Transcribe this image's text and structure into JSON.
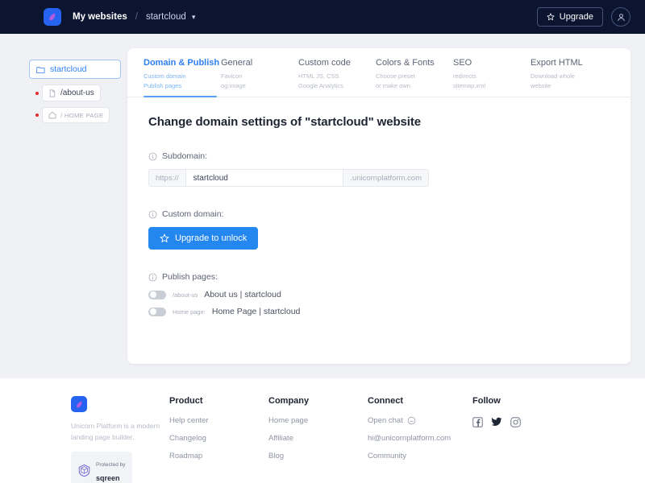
{
  "topbar": {
    "logo_icon": "unicorn-droplet-logo",
    "breadcrumb_root": "My websites",
    "breadcrumb_separator": "/",
    "breadcrumb_current": "startcloud",
    "caret_icon": "chevron-down-icon",
    "upgrade_label": "Upgrade",
    "upgrade_icon": "star-icon",
    "avatar_icon": "user-avatar-icon",
    "bg_color": "#0b1530"
  },
  "tree": {
    "root": {
      "label": "startcloud",
      "icon": "folder-icon"
    },
    "children": [
      {
        "label": "/about-us",
        "icon": "page-icon",
        "status_dot": "#e02b2b",
        "muted": false,
        "slash": ""
      },
      {
        "label": "/ HOME PAGE",
        "icon": "home-icon",
        "status_dot": "#e02b2b",
        "muted": true,
        "slash": ""
      }
    ]
  },
  "tabs": [
    {
      "title": "Domain & Publish",
      "sub1": "Custom domain",
      "sub2": "Publish pages",
      "active": true
    },
    {
      "title": "General",
      "sub1": "Favicon",
      "sub2": "og:image",
      "active": false
    },
    {
      "title": "Custom code",
      "sub1": "HTML JS, CSS",
      "sub2": "Google Analytics",
      "active": false
    },
    {
      "title": "Colors & Fonts",
      "sub1": "Choose preset",
      "sub2": "or make own",
      "active": false
    },
    {
      "title": "SEO",
      "sub1": "redirects",
      "sub2": "sitemap.xml",
      "active": false
    },
    {
      "title": "Export HTML",
      "sub1": "Download whole",
      "sub2": "website",
      "active": false
    }
  ],
  "main": {
    "page_title": "Change domain settings of \"startcloud\" website",
    "subdomain": {
      "label": "Subdomain:",
      "info_icon": "info-icon",
      "prefix": "https://",
      "value": "startcloud",
      "placeholder": "startcloud",
      "suffix": ".unicornplatform.com"
    },
    "custom_domain": {
      "label": "Custom domain:",
      "info_icon": "info-icon",
      "button_label": "Upgrade to unlock",
      "button_icon": "star-icon",
      "button_color": "#2487f0"
    },
    "publish_pages": {
      "label": "Publish pages:",
      "info_icon": "info-icon",
      "rows": [
        {
          "tag": "/about-us",
          "name": "About us | startcloud",
          "enabled": false
        },
        {
          "tag": "Home page:",
          "name": "Home Page | startcloud",
          "enabled": false
        }
      ]
    }
  },
  "footer": {
    "logo_icon": "unicorn-droplet-logo",
    "tagline": "Unicorn Platform is a modern landing page builder.",
    "badge": {
      "icon": "sqreen-shield-icon",
      "line1": "Protected by",
      "line2": "sqreen"
    },
    "columns": [
      {
        "heading": "Product",
        "links": [
          {
            "label": "Help center",
            "icon": ""
          },
          {
            "label": "Changelog",
            "icon": ""
          },
          {
            "label": "Roadmap",
            "icon": ""
          }
        ]
      },
      {
        "heading": "Company",
        "links": [
          {
            "label": "Home page",
            "icon": ""
          },
          {
            "label": "Affiliate",
            "icon": ""
          },
          {
            "label": "Blog",
            "icon": ""
          }
        ]
      },
      {
        "heading": "Connect",
        "links": [
          {
            "label": "Open chat",
            "icon": "chat-bubble-icon"
          },
          {
            "label": "hi@unicornplatform.com",
            "icon": ""
          },
          {
            "label": "Community",
            "icon": ""
          }
        ]
      }
    ],
    "follow": {
      "heading": "Follow",
      "socials": [
        {
          "name": "facebook-icon"
        },
        {
          "name": "twitter-icon"
        },
        {
          "name": "instagram-icon"
        }
      ]
    }
  }
}
